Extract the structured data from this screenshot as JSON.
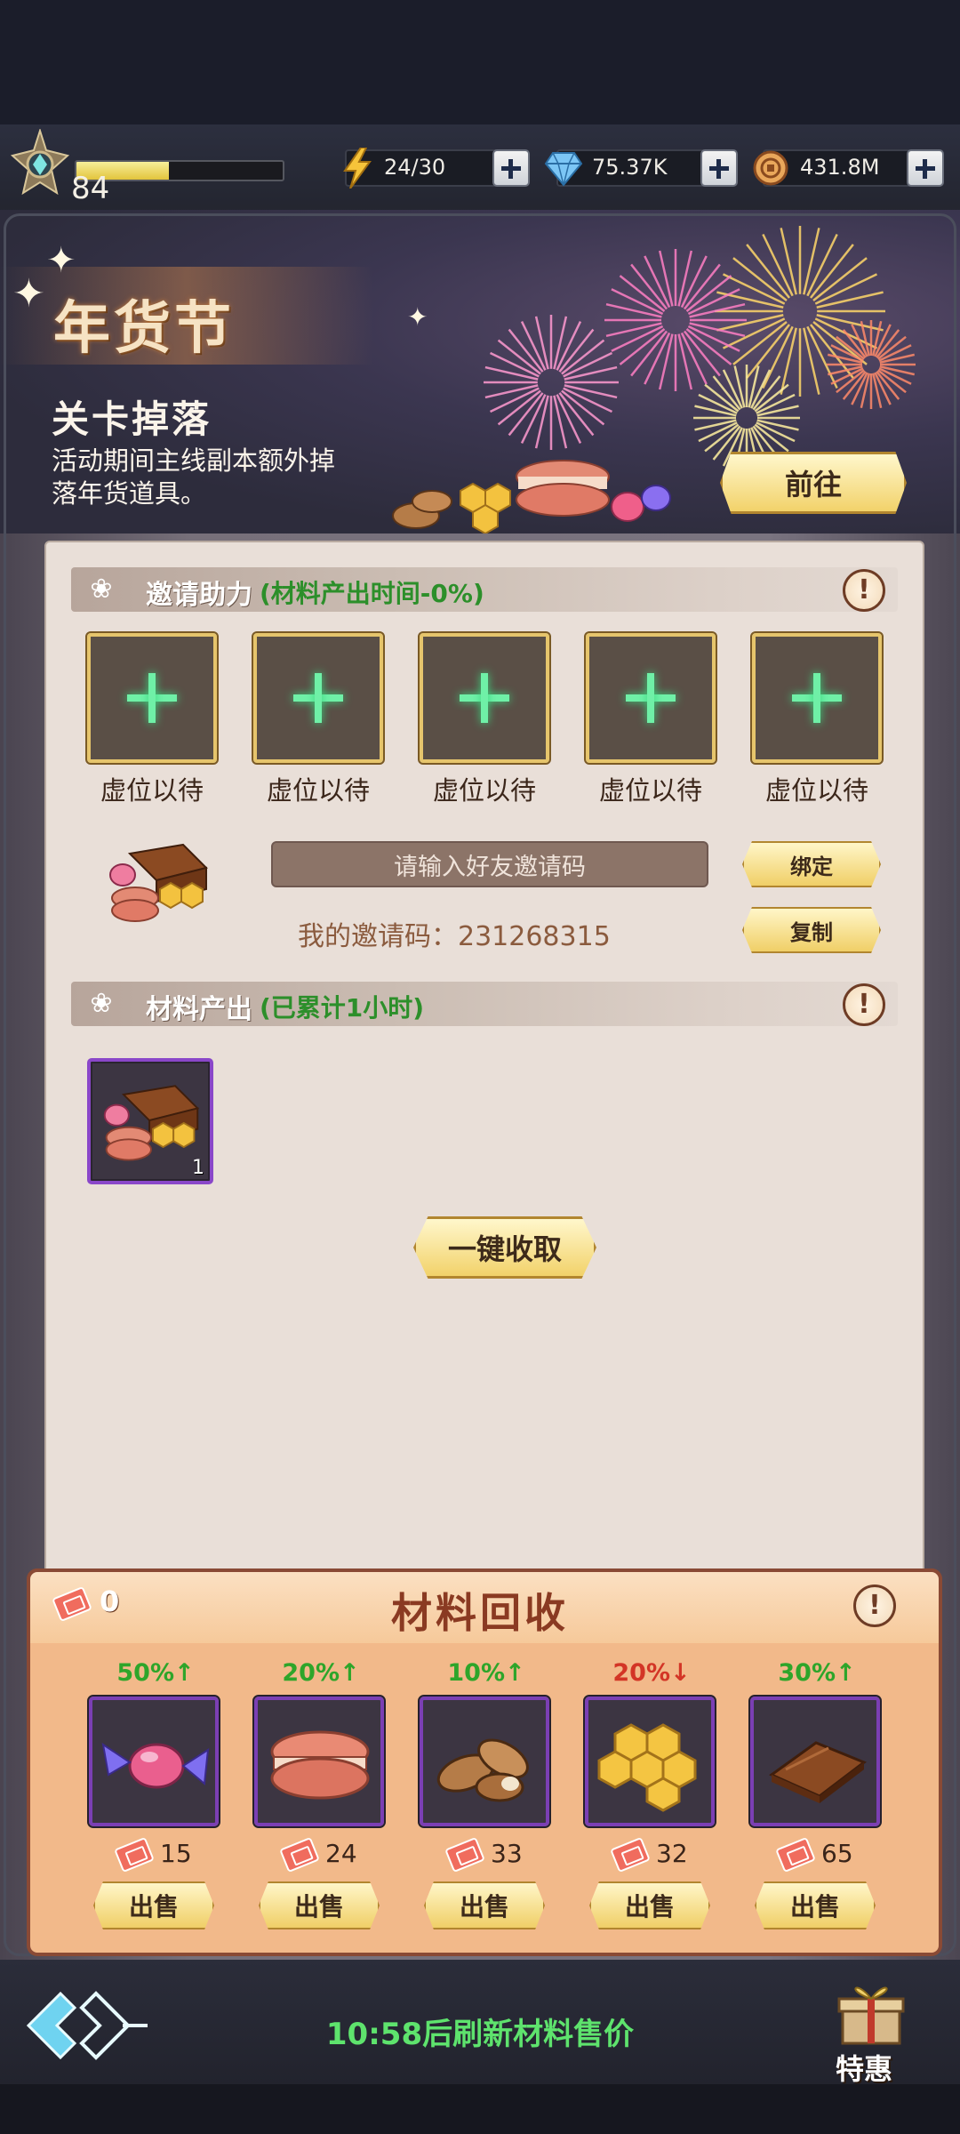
{
  "topbar": {
    "level": "84",
    "exp_fraction": 0.45,
    "energy": "24/30",
    "gems": "75.37K",
    "coins": "431.8M"
  },
  "hero": {
    "title": "年货节",
    "subtitle": "关卡掉落",
    "description": "活动期间主线副本额外掉落年货道具。",
    "goto_label": "前往"
  },
  "invite": {
    "section_title": "邀请助力",
    "section_note": "(材料产出时间-0%)",
    "slots": [
      {
        "label": "虚位以待"
      },
      {
        "label": "虚位以待"
      },
      {
        "label": "虚位以待"
      },
      {
        "label": "虚位以待"
      },
      {
        "label": "虚位以待"
      }
    ],
    "input_placeholder": "请输入好友邀请码",
    "bind_label": "绑定",
    "copy_label": "复制",
    "my_code_label": "我的邀请码：231268315"
  },
  "output": {
    "section_title": "材料产出",
    "section_note": "(已累计1小时)",
    "item_count": "1",
    "collect_label": "一键收取"
  },
  "recycle": {
    "title": "材料回收",
    "ticket_count": "0",
    "materials": [
      {
        "name": "candy-icon",
        "pct": "50%↑",
        "dir": "up",
        "price": "15",
        "sell": "出售"
      },
      {
        "name": "macaron-icon",
        "pct": "20%↑",
        "dir": "up",
        "price": "24",
        "sell": "出售"
      },
      {
        "name": "almond-icon",
        "pct": "10%↑",
        "dir": "up",
        "price": "33",
        "sell": "出售"
      },
      {
        "name": "honeycomb-icon",
        "pct": "20%↓",
        "dir": "down",
        "price": "32",
        "sell": "出售"
      },
      {
        "name": "chocolate-icon",
        "pct": "30%↑",
        "dir": "up",
        "price": "65",
        "sell": "出售"
      }
    ]
  },
  "footer": {
    "refresh_text": "10:58后刷新材料售价",
    "deal_label": "特惠"
  },
  "colors": {
    "accent_green": "#5ee36d",
    "up": "#2ea52a",
    "down": "#d33526",
    "gold": "#f2d26a",
    "rare_purple": "#8a47c9"
  }
}
